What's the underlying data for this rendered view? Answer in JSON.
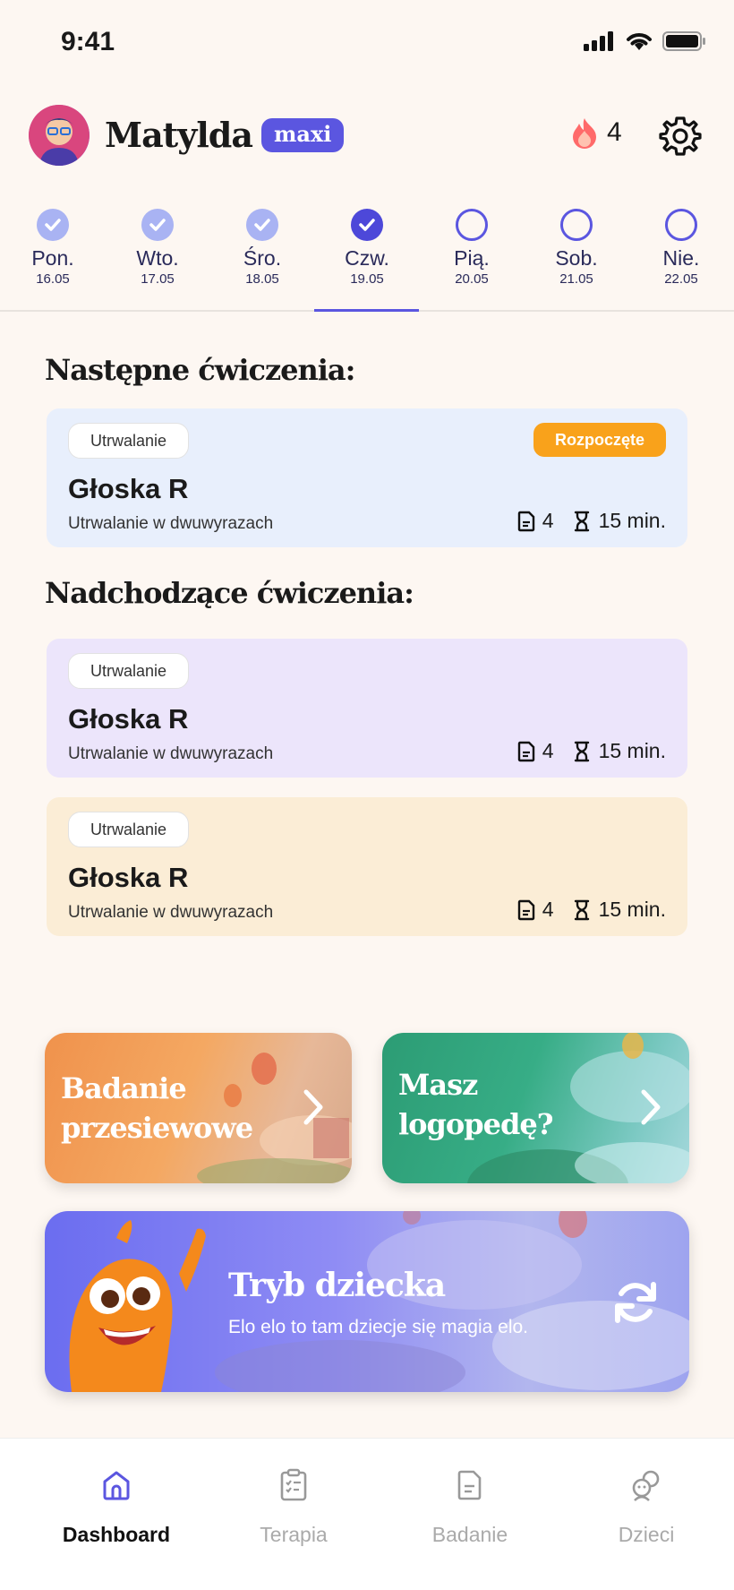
{
  "status_bar": {
    "time": "9:41"
  },
  "header": {
    "username": "Matylda",
    "plan_badge": "maxi",
    "streak_count": "4"
  },
  "week": {
    "days": [
      {
        "name": "Pon.",
        "date": "16.05",
        "state": "done"
      },
      {
        "name": "Wto.",
        "date": "17.05",
        "state": "done"
      },
      {
        "name": "Śro.",
        "date": "18.05",
        "state": "done"
      },
      {
        "name": "Czw.",
        "date": "19.05",
        "state": "done-selected"
      },
      {
        "name": "Pią.",
        "date": "20.05",
        "state": "open"
      },
      {
        "name": "Sob.",
        "date": "21.05",
        "state": "open"
      },
      {
        "name": "Nie.",
        "date": "22.05",
        "state": "open"
      }
    ]
  },
  "next_section": {
    "title": "Następne ćwiczenia:",
    "card": {
      "tag": "Utrwalanie",
      "status": "Rozpoczęte",
      "title": "Głoska R",
      "subtitle": "Utrwalanie w dwuwyrazach",
      "count": "4",
      "duration": "15 min.",
      "color": "#e8effc"
    }
  },
  "upcoming_section": {
    "title": "Nadchodzące ćwiczenia:",
    "cards": [
      {
        "tag": "Utrwalanie",
        "title": "Głoska R",
        "subtitle": "Utrwalanie w dwuwyrazach",
        "count": "4",
        "duration": "15 min.",
        "color": "#ece5fb"
      },
      {
        "tag": "Utrwalanie",
        "title": "Głoska R",
        "subtitle": "Utrwalanie w dwuwyrazach",
        "count": "4",
        "duration": "15 min.",
        "color": "#fbedd6"
      }
    ]
  },
  "promo_tiles": [
    {
      "title_line1": "Badanie",
      "title_line2": "przesiewowe",
      "color": "#f29a55"
    },
    {
      "title_line1": "Masz",
      "title_line2": "logopedę?",
      "color": "#2aa37c"
    }
  ],
  "kid_mode": {
    "title": "Tryb dziecka",
    "subtitle": "Elo elo to tam dziecje się magia elo."
  },
  "tabbar": {
    "tabs": [
      {
        "label": "Dashboard",
        "icon": "home-icon",
        "active": true
      },
      {
        "label": "Terapia",
        "icon": "clipboard-icon",
        "active": false
      },
      {
        "label": "Badanie",
        "icon": "document-icon",
        "active": false
      },
      {
        "label": "Dzieci",
        "icon": "children-icon",
        "active": false
      }
    ]
  },
  "colors": {
    "accent": "#5b56e0",
    "status_orange": "#f9a21b",
    "background": "#fdf7f2"
  }
}
